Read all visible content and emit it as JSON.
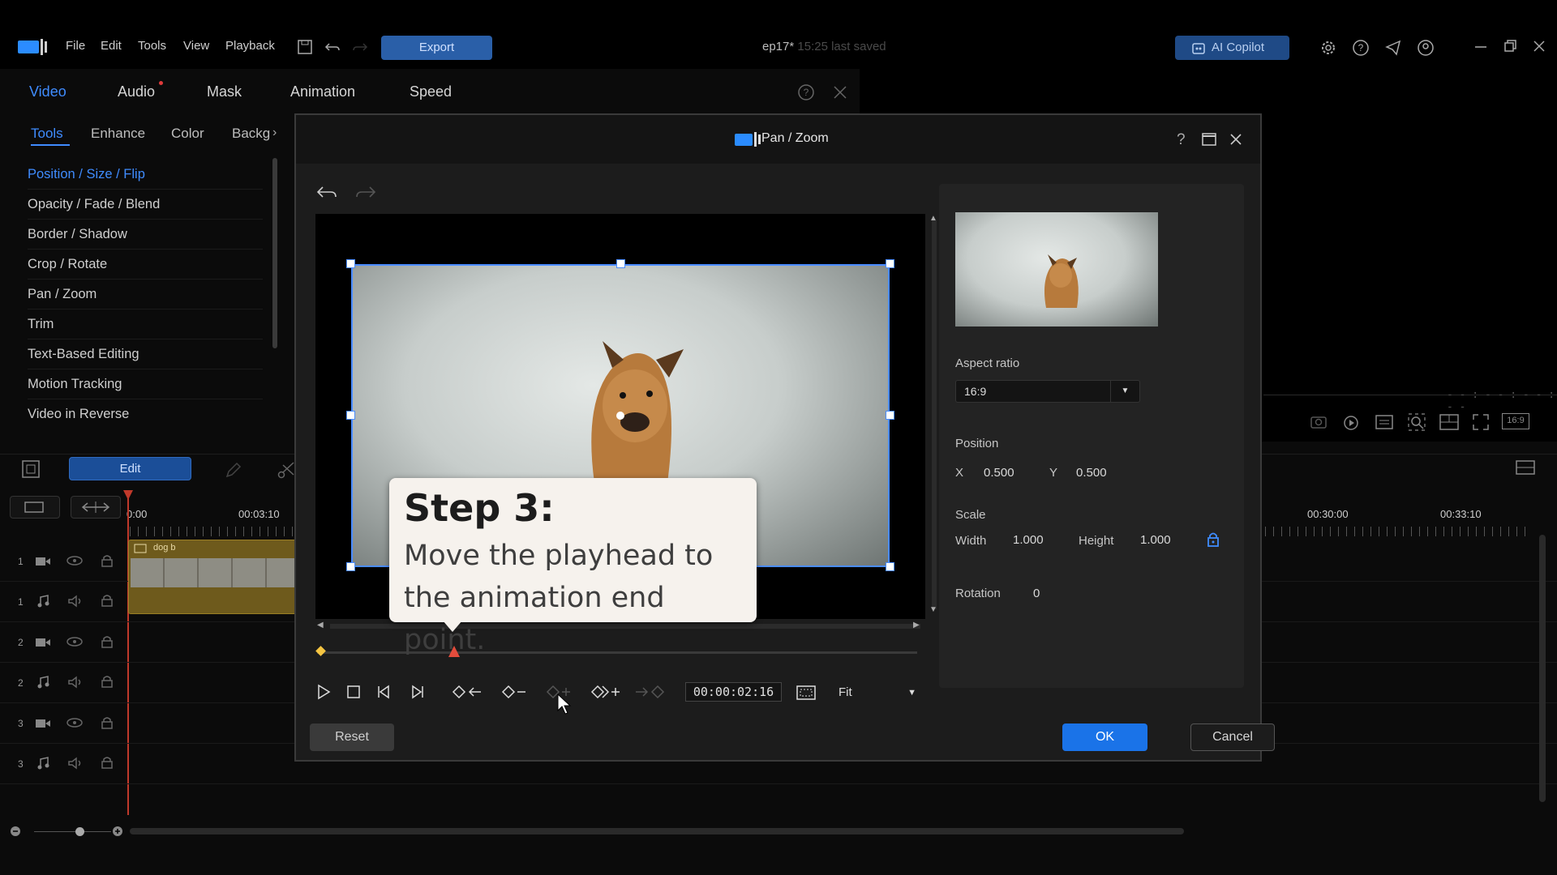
{
  "app": {
    "menu": [
      "File",
      "Edit",
      "Tools",
      "View",
      "Playback"
    ],
    "export_label": "Export",
    "title": "ep17*",
    "saved_status": "15:25 last saved",
    "copilot_label": "AI Copilot"
  },
  "left_panel": {
    "main_tabs": [
      "Video",
      "Audio",
      "Mask",
      "Animation",
      "Speed"
    ],
    "sub_tabs": [
      "Tools",
      "Enhance",
      "Color",
      "Backg"
    ],
    "tools": [
      "Position / Size / Flip",
      "Opacity / Fade / Blend",
      "Border / Shadow",
      "Crop / Rotate",
      "Pan / Zoom",
      "Trim",
      "Text-Based Editing",
      "Motion Tracking",
      "Video in Reverse"
    ],
    "edit_label": "Edit"
  },
  "timeline": {
    "ticks": [
      "0:00",
      "00:03:10",
      "00:30:00",
      "00:33:10"
    ],
    "clip_label": "dog b",
    "track_numbers": [
      "1",
      "1",
      "2",
      "2",
      "3",
      "3"
    ]
  },
  "dialog": {
    "title": "Pan / Zoom",
    "aspect_ratio_label": "Aspect ratio",
    "aspect_ratio_value": "16:9",
    "position_label": "Position",
    "x_label": "X",
    "x_value": "0.500",
    "y_label": "Y",
    "y_value": "0.500",
    "scale_label": "Scale",
    "width_label": "Width",
    "width_value": "1.000",
    "height_label": "Height",
    "height_value": "1.000",
    "rotation_label": "Rotation",
    "rotation_value": "0",
    "timecode": "00:00:02:16",
    "fit_label": "Fit",
    "reset_label": "Reset",
    "ok_label": "OK",
    "cancel_label": "Cancel"
  },
  "tooltip": {
    "heading": "Step 3:",
    "body": "Move the playhead to the animation end point."
  },
  "colors": {
    "accent_blue": "#1a73e8",
    "active_tab": "#3f8cff",
    "selection_border": "#4a8cff"
  }
}
